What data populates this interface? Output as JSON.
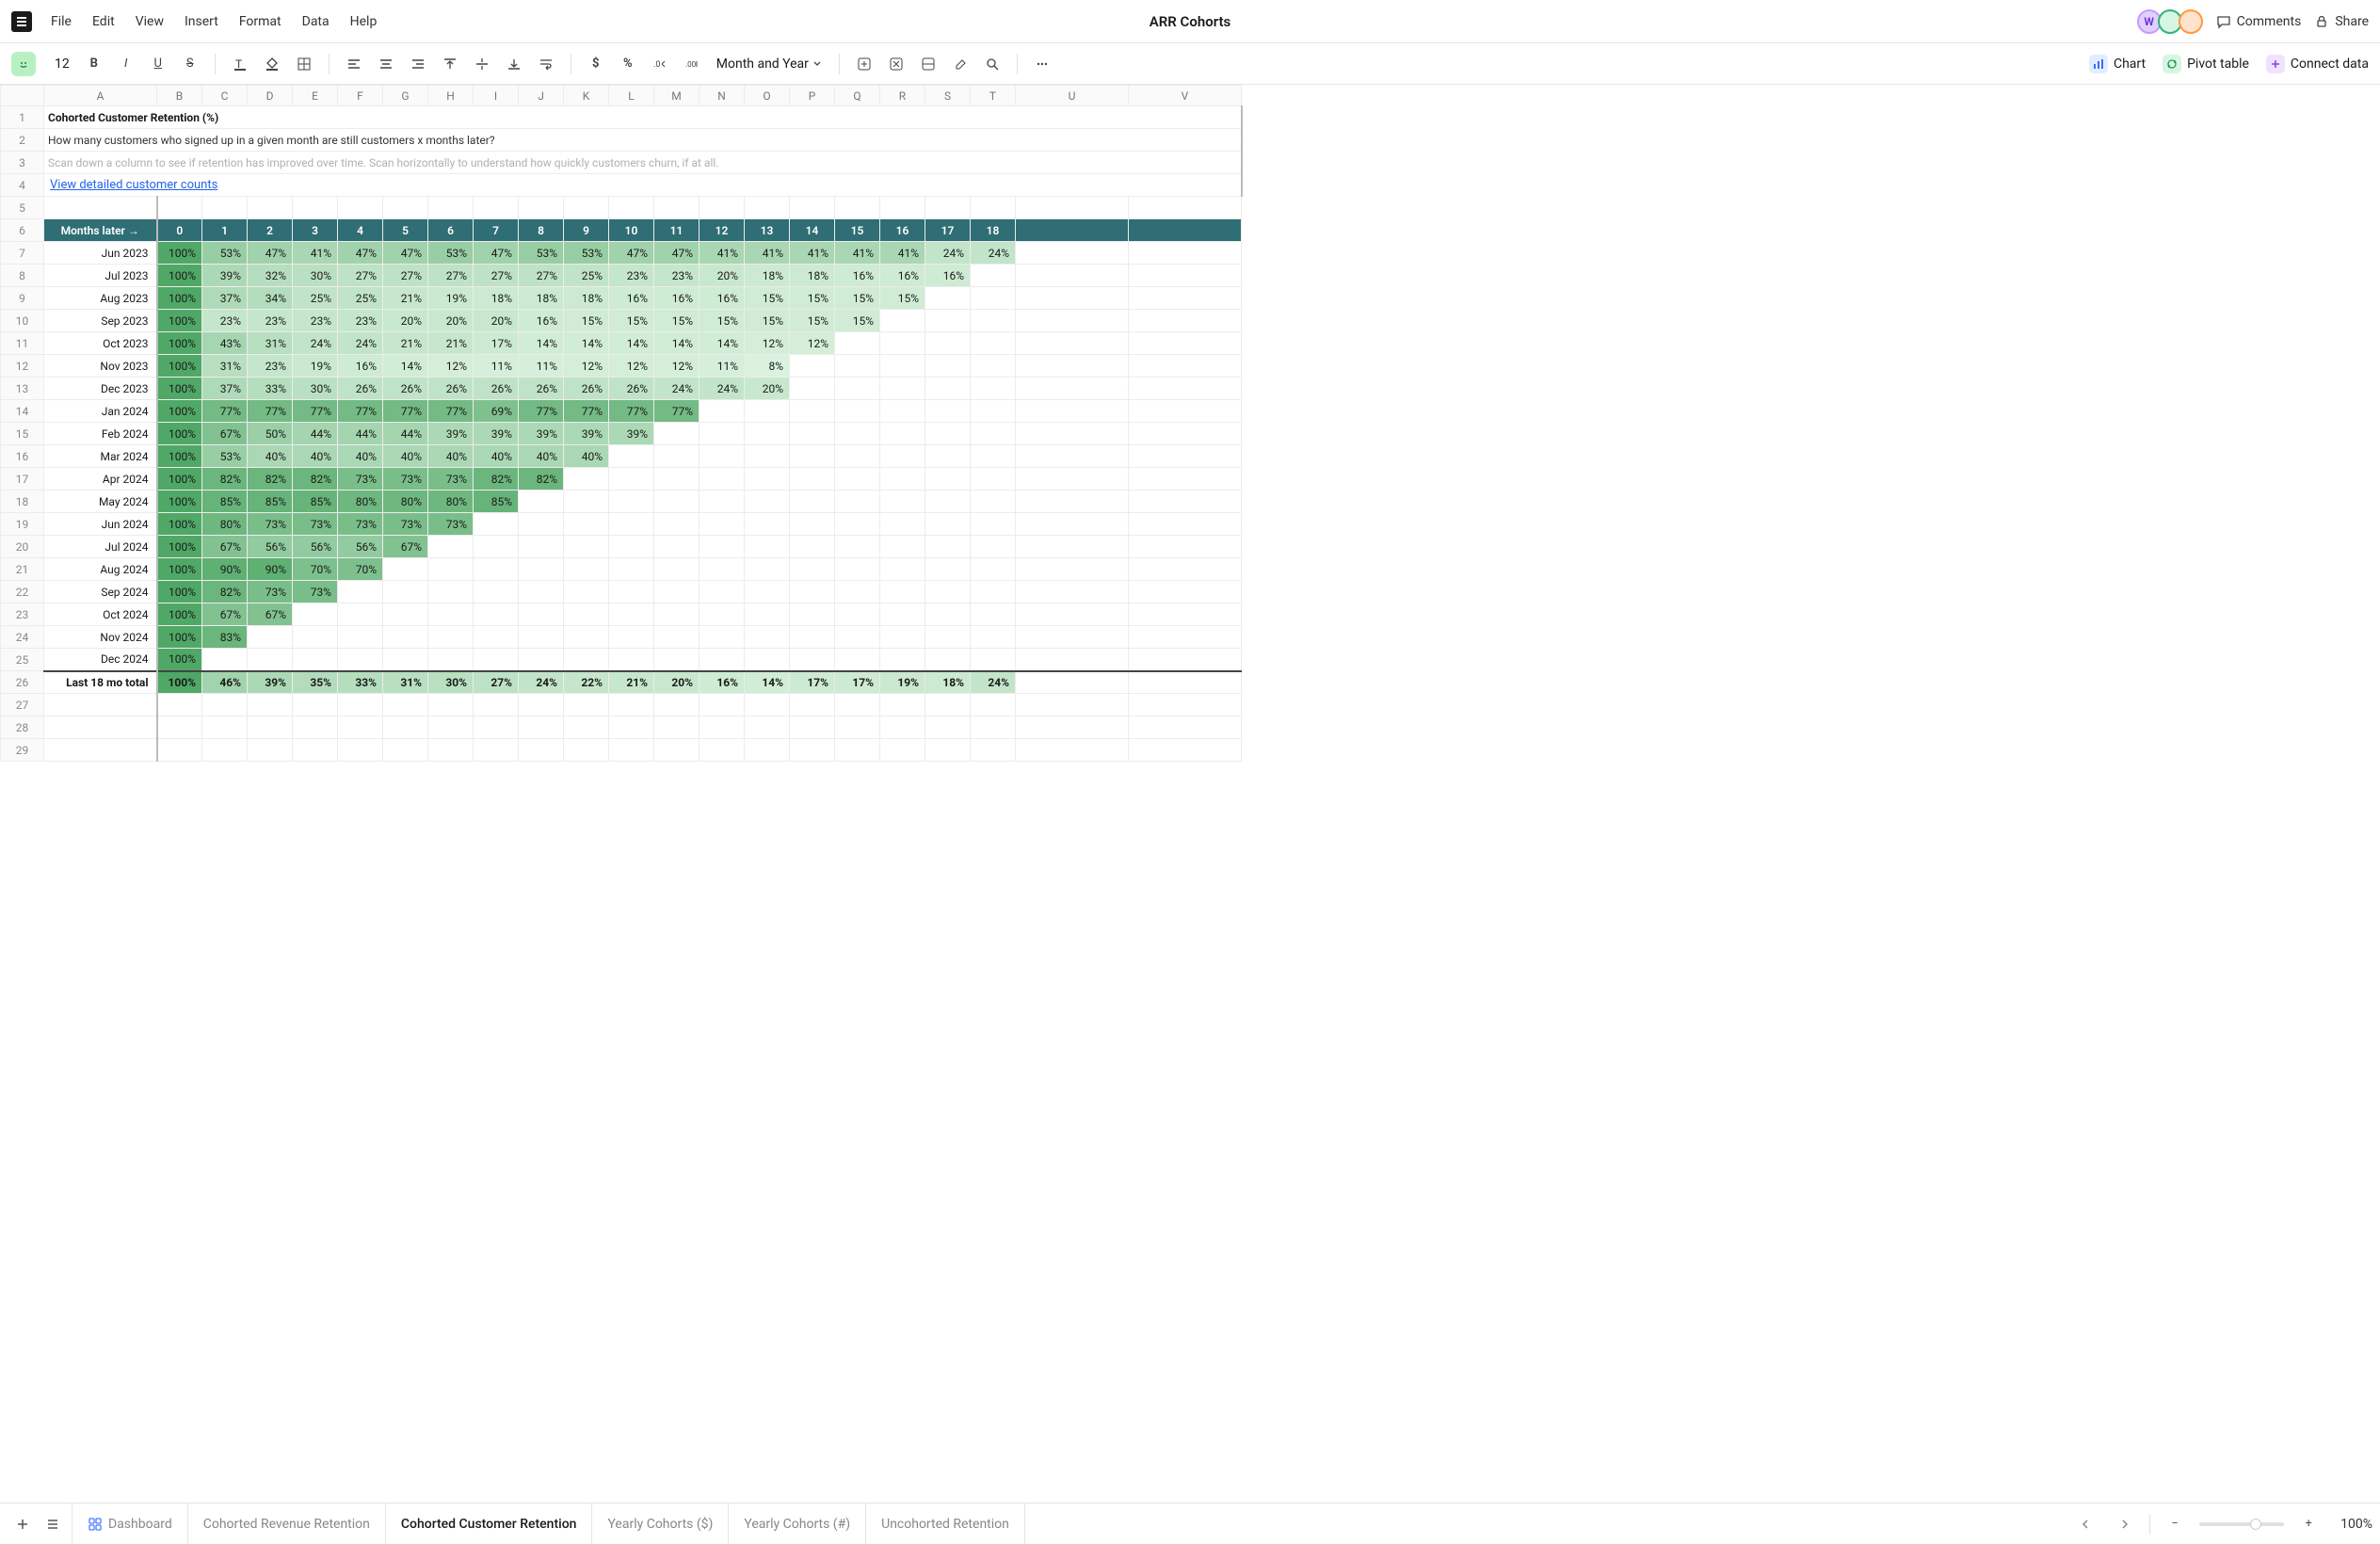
{
  "doc_title": "ARR Cohorts",
  "menu": [
    "File",
    "Edit",
    "View",
    "Insert",
    "Format",
    "Data",
    "Help"
  ],
  "top_right": {
    "comments": "Comments",
    "share": "Share",
    "avatar_initial": "W"
  },
  "toolbar": {
    "font_size": "12",
    "format_dropdown": "Month and Year",
    "chart": "Chart",
    "pivot": "Pivot table",
    "connect": "Connect data"
  },
  "columns": [
    "A",
    "B",
    "C",
    "D",
    "E",
    "F",
    "G",
    "H",
    "I",
    "J",
    "K",
    "L",
    "M",
    "N",
    "O",
    "P",
    "Q",
    "R",
    "S",
    "T",
    "U",
    "V"
  ],
  "row_numbers": [
    1,
    2,
    3,
    4,
    5,
    6,
    7,
    8,
    9,
    10,
    11,
    12,
    13,
    14,
    15,
    16,
    17,
    18,
    19,
    20,
    21,
    22,
    23,
    24,
    25,
    26,
    27,
    28,
    29
  ],
  "sheet": {
    "title": "Cohorted Customer Retention (%)",
    "subtitle": "How many customers who signed up in a given month are still customers x months later?",
    "hint": "Scan down a column to see if retention has improved over time. Scan horizontally to understand how quickly customers churn, if at all.",
    "link": "View detailed customer counts",
    "months_label": "Months later →",
    "month_headers": [
      "0",
      "1",
      "2",
      "3",
      "4",
      "5",
      "6",
      "7",
      "8",
      "9",
      "10",
      "11",
      "12",
      "13",
      "14",
      "15",
      "16",
      "17",
      "18"
    ],
    "total_label": "Last 18 mo total"
  },
  "cohorts": [
    {
      "label": "Jun 2023",
      "vals": [
        100,
        53,
        47,
        41,
        47,
        47,
        53,
        47,
        53,
        53,
        47,
        47,
        41,
        41,
        41,
        41,
        41,
        24,
        24
      ]
    },
    {
      "label": "Jul 2023",
      "vals": [
        100,
        39,
        32,
        30,
        27,
        27,
        27,
        27,
        27,
        25,
        23,
        23,
        20,
        18,
        18,
        16,
        16,
        16,
        null
      ]
    },
    {
      "label": "Aug 2023",
      "vals": [
        100,
        37,
        34,
        25,
        25,
        21,
        19,
        18,
        18,
        18,
        16,
        16,
        16,
        15,
        15,
        15,
        15,
        null,
        null
      ]
    },
    {
      "label": "Sep 2023",
      "vals": [
        100,
        23,
        23,
        23,
        23,
        20,
        20,
        20,
        16,
        15,
        15,
        15,
        15,
        15,
        15,
        15,
        null,
        null,
        null
      ]
    },
    {
      "label": "Oct 2023",
      "vals": [
        100,
        43,
        31,
        24,
        24,
        21,
        21,
        17,
        14,
        14,
        14,
        14,
        14,
        12,
        12,
        null,
        null,
        null,
        null
      ]
    },
    {
      "label": "Nov 2023",
      "vals": [
        100,
        31,
        23,
        19,
        16,
        14,
        12,
        11,
        11,
        12,
        12,
        12,
        11,
        8,
        null,
        null,
        null,
        null,
        null
      ]
    },
    {
      "label": "Dec 2023",
      "vals": [
        100,
        37,
        33,
        30,
        26,
        26,
        26,
        26,
        26,
        26,
        26,
        24,
        24,
        20,
        null,
        null,
        null,
        null,
        null
      ]
    },
    {
      "label": "Jan 2024",
      "vals": [
        100,
        77,
        77,
        77,
        77,
        77,
        77,
        69,
        77,
        77,
        77,
        77,
        null,
        null,
        null,
        null,
        null,
        null,
        null
      ]
    },
    {
      "label": "Feb 2024",
      "vals": [
        100,
        67,
        50,
        44,
        44,
        44,
        39,
        39,
        39,
        39,
        39,
        null,
        null,
        null,
        null,
        null,
        null,
        null,
        null
      ]
    },
    {
      "label": "Mar 2024",
      "vals": [
        100,
        53,
        40,
        40,
        40,
        40,
        40,
        40,
        40,
        40,
        null,
        null,
        null,
        null,
        null,
        null,
        null,
        null,
        null
      ]
    },
    {
      "label": "Apr 2024",
      "vals": [
        100,
        82,
        82,
        82,
        73,
        73,
        73,
        82,
        82,
        null,
        null,
        null,
        null,
        null,
        null,
        null,
        null,
        null,
        null
      ]
    },
    {
      "label": "May 2024",
      "vals": [
        100,
        85,
        85,
        85,
        80,
        80,
        80,
        85,
        null,
        null,
        null,
        null,
        null,
        null,
        null,
        null,
        null,
        null,
        null
      ]
    },
    {
      "label": "Jun 2024",
      "vals": [
        100,
        80,
        73,
        73,
        73,
        73,
        73,
        null,
        null,
        null,
        null,
        null,
        null,
        null,
        null,
        null,
        null,
        null,
        null
      ]
    },
    {
      "label": "Jul 2024",
      "vals": [
        100,
        67,
        56,
        56,
        56,
        67,
        null,
        null,
        null,
        null,
        null,
        null,
        null,
        null,
        null,
        null,
        null,
        null,
        null
      ]
    },
    {
      "label": "Aug 2024",
      "vals": [
        100,
        90,
        90,
        70,
        70,
        null,
        null,
        null,
        null,
        null,
        null,
        null,
        null,
        null,
        null,
        null,
        null,
        null,
        null
      ]
    },
    {
      "label": "Sep 2024",
      "vals": [
        100,
        82,
        73,
        73,
        null,
        null,
        null,
        null,
        null,
        null,
        null,
        null,
        null,
        null,
        null,
        null,
        null,
        null,
        null
      ]
    },
    {
      "label": "Oct 2024",
      "vals": [
        100,
        67,
        67,
        null,
        null,
        null,
        null,
        null,
        null,
        null,
        null,
        null,
        null,
        null,
        null,
        null,
        null,
        null,
        null
      ]
    },
    {
      "label": "Nov 2024",
      "vals": [
        100,
        83,
        null,
        null,
        null,
        null,
        null,
        null,
        null,
        null,
        null,
        null,
        null,
        null,
        null,
        null,
        null,
        null,
        null
      ]
    },
    {
      "label": "Dec 2024",
      "vals": [
        100,
        null,
        null,
        null,
        null,
        null,
        null,
        null,
        null,
        null,
        null,
        null,
        null,
        null,
        null,
        null,
        null,
        null,
        null
      ]
    }
  ],
  "totals": [
    100,
    46,
    39,
    35,
    33,
    31,
    30,
    27,
    24,
    22,
    21,
    20,
    16,
    14,
    17,
    17,
    19,
    18,
    24
  ],
  "bottom_tabs": [
    "Dashboard",
    "Cohorted Revenue Retention",
    "Cohorted Customer Retention",
    "Yearly Cohorts ($)",
    "Yearly Cohorts (#)",
    "Uncohorted Retention"
  ],
  "active_tab": 2,
  "zoom": "100%"
}
